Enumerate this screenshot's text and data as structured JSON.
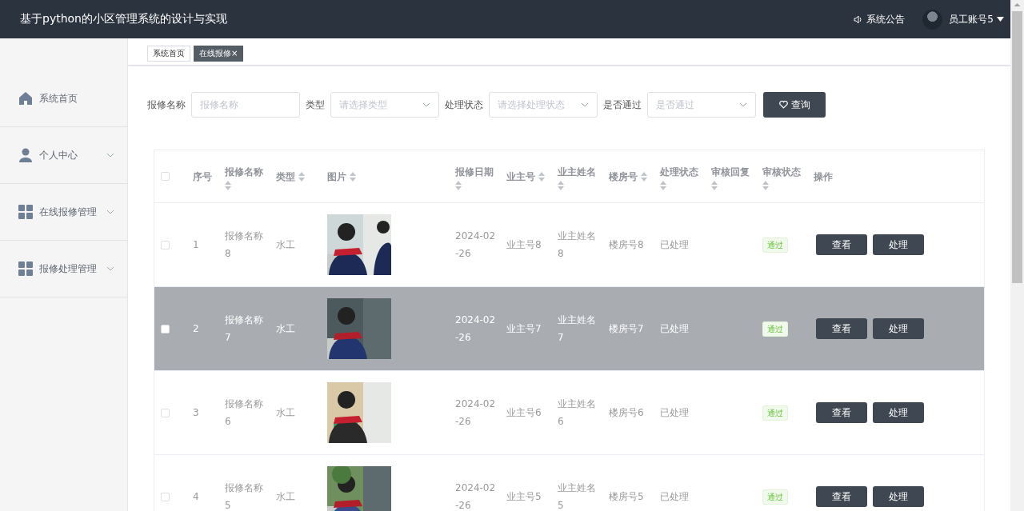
{
  "header": {
    "title": "基于python的小区管理系统的设计与实现",
    "notice": "系统公告",
    "user": "员工账号5"
  },
  "sidebar": {
    "items": [
      {
        "label": "系统首页",
        "kind": "home",
        "expandable": false
      },
      {
        "label": "个人中心",
        "kind": "user",
        "expandable": true
      },
      {
        "label": "在线报修管理",
        "kind": "grid",
        "expandable": true
      },
      {
        "label": "报修处理管理",
        "kind": "grid",
        "expandable": true
      }
    ]
  },
  "tabs": [
    {
      "label": "系统首页",
      "selected": false
    },
    {
      "label": "在线报修",
      "selected": true,
      "close_mark": "×"
    }
  ],
  "filters": [
    {
      "label": "报修名称",
      "kind": "input",
      "placeholder": "报修名称"
    },
    {
      "label": "类型",
      "kind": "select",
      "placeholder": "请选择类型"
    },
    {
      "label": "处理状态",
      "kind": "select",
      "placeholder": "请选择处理状态"
    },
    {
      "label": "是否通过",
      "kind": "select",
      "placeholder": "是否通过"
    }
  ],
  "search_button": "查询",
  "table": {
    "columns": [
      {
        "kind": "checkbox",
        "checked": false
      },
      {
        "label": "序号",
        "sortable": false
      },
      {
        "label": "报修名称",
        "sortable": true
      },
      {
        "label": "类型",
        "sortable": true
      },
      {
        "label": "图片",
        "sortable": true
      },
      {
        "label": "报修日期",
        "sortable": true
      },
      {
        "label": "业主号",
        "sortable": true
      },
      {
        "label": "业主姓名",
        "sortable": true
      },
      {
        "label": "楼房号",
        "sortable": true
      },
      {
        "label": "处理状态",
        "sortable": true
      },
      {
        "label": "审核回复",
        "sortable": true
      },
      {
        "label": "审核状态",
        "sortable": true
      },
      {
        "label": "操作",
        "sortable": false
      }
    ],
    "rows": [
      {
        "selected": false,
        "checked": false,
        "index": "1",
        "name": "报修名称8",
        "type": "水工",
        "date": "2024-02-26",
        "owner_no": "业主号8",
        "owner_name": "业主姓名8",
        "building": "楼房号8",
        "status": "已处理",
        "review": "通过",
        "actions": [
          "查看",
          "处理"
        ]
      },
      {
        "selected": true,
        "checked": false,
        "index": "2",
        "name": "报修名称7",
        "type": "水工",
        "date": "2024-02-26",
        "owner_no": "业主号7",
        "owner_name": "业主姓名7",
        "building": "楼房号7",
        "status": "已处理",
        "review": "通过",
        "actions": [
          "查看",
          "处理"
        ]
      },
      {
        "selected": false,
        "checked": false,
        "index": "3",
        "name": "报修名称6",
        "type": "水工",
        "date": "2024-02-26",
        "owner_no": "业主号6",
        "owner_name": "业主姓名6",
        "building": "楼房号6",
        "status": "已处理",
        "review": "通过",
        "actions": [
          "查看",
          "处理"
        ]
      },
      {
        "selected": false,
        "checked": false,
        "index": "4",
        "name": "报修名称5",
        "type": "水工",
        "date": "2024-02-26",
        "owner_no": "业主号5",
        "owner_name": "业主姓名5",
        "building": "楼房号5",
        "status": "已处理",
        "review": "通过",
        "actions": [
          "查看",
          "处理"
        ]
      }
    ]
  }
}
